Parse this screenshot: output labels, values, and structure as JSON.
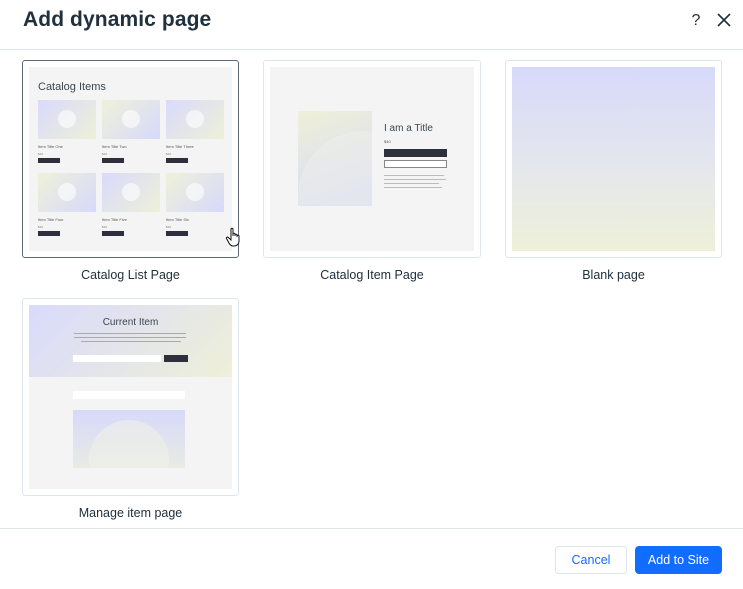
{
  "dialog": {
    "title": "Add dynamic page",
    "help_icon": "?",
    "close_icon": "close-icon"
  },
  "templates": [
    {
      "label": "Catalog List Page",
      "selected": true,
      "preview": {
        "heading": "Catalog Items",
        "items": [
          {
            "name": "Item Title One",
            "price": "$10",
            "button": "Buy Now"
          },
          {
            "name": "Item Title Two",
            "price": "$10",
            "button": "Buy Now"
          },
          {
            "name": "Item Title Three",
            "price": "$10",
            "button": "Buy Now"
          },
          {
            "name": "Item Title Four",
            "price": "$10",
            "button": "Buy Now"
          },
          {
            "name": "Item Title Five",
            "price": "$10",
            "button": "Buy Now"
          },
          {
            "name": "Item Title Six",
            "price": "$10",
            "button": "Buy Now"
          }
        ]
      }
    },
    {
      "label": "Catalog Item Page",
      "selected": false,
      "preview": {
        "heading": "I am a Title",
        "price": "$40"
      }
    },
    {
      "label": "Blank page",
      "selected": false
    },
    {
      "label": "Manage item page",
      "selected": false,
      "preview": {
        "heading": "Current Item"
      }
    }
  ],
  "footer": {
    "cancel_label": "Cancel",
    "add_label": "Add to Site"
  },
  "colors": {
    "accent": "#116dff",
    "text": "#20303c",
    "border": "#dfe5eb"
  }
}
